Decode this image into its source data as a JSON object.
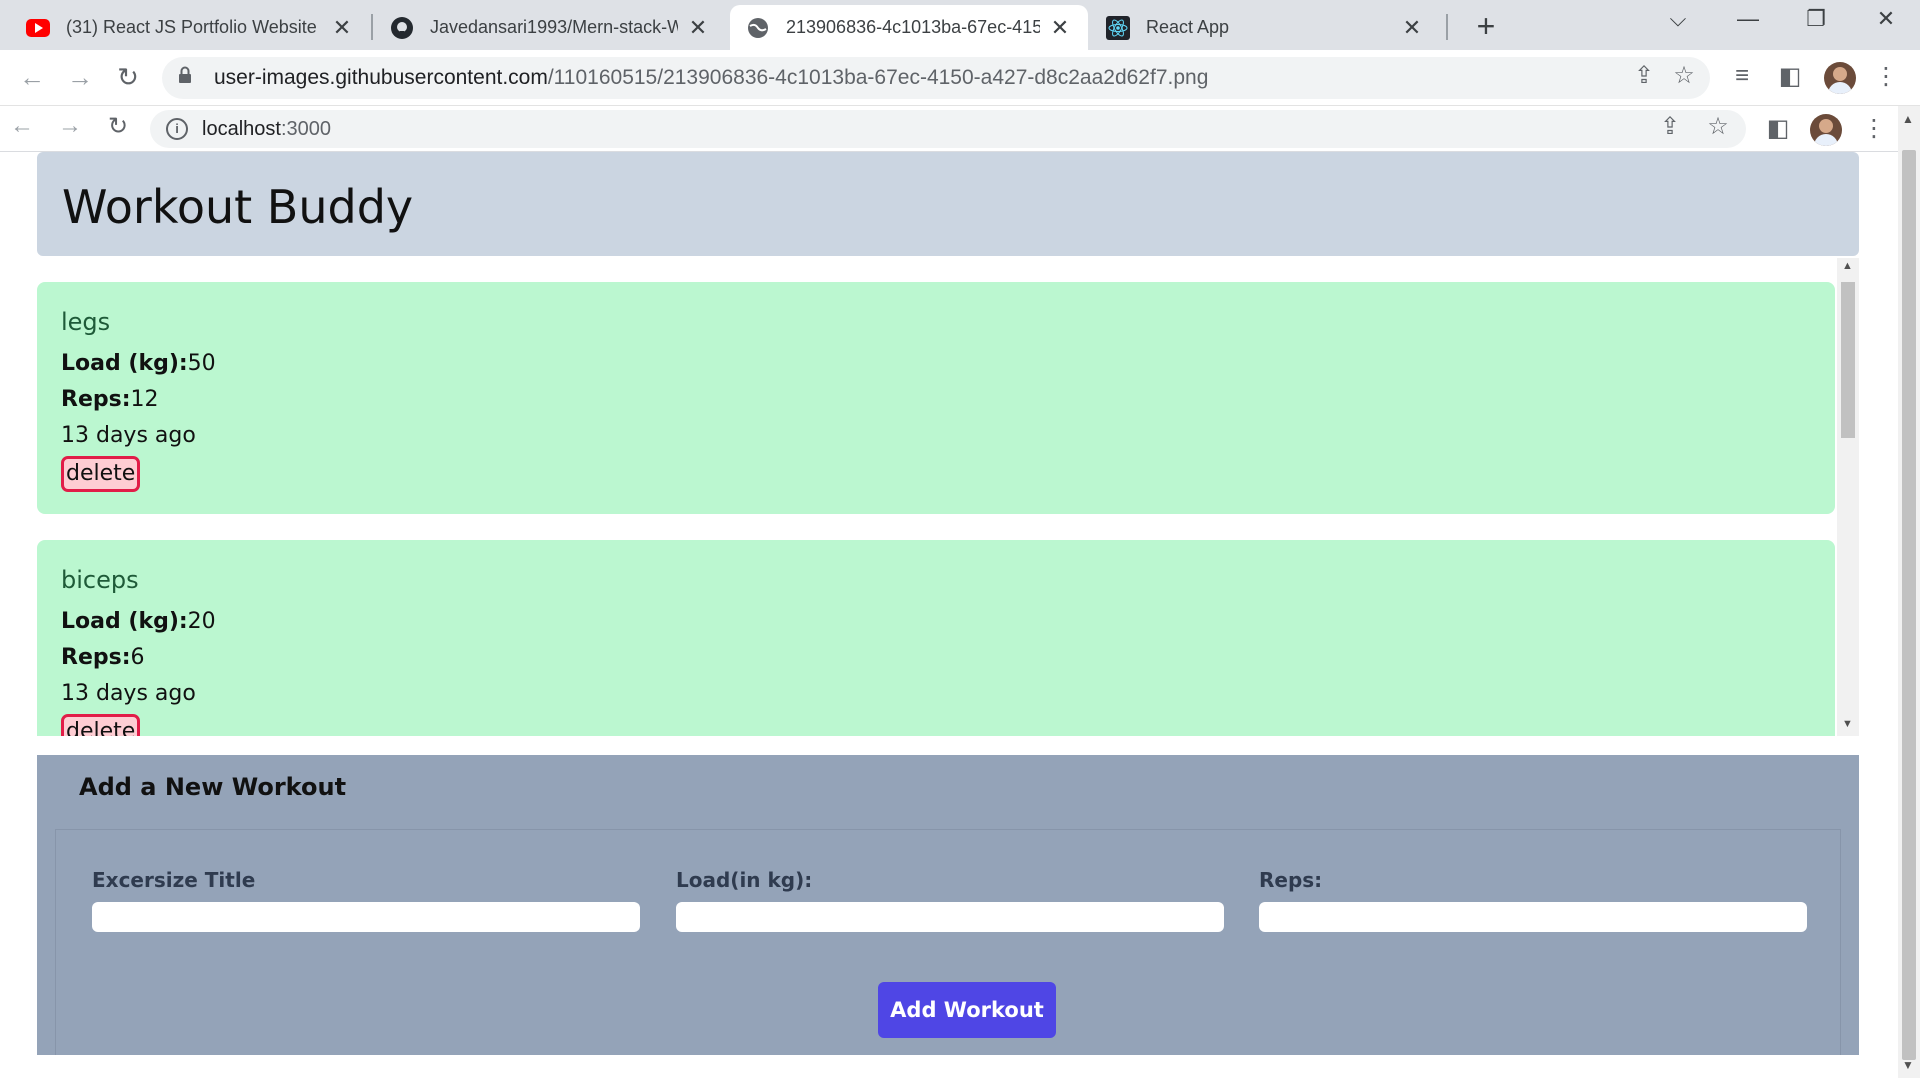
{
  "outer_browser": {
    "tabs": [
      {
        "title": "(31) React JS Portfolio Website Us",
        "icon": "youtube-icon"
      },
      {
        "title": "Javedansari1993/Mern-stack-Wo",
        "icon": "github-icon"
      },
      {
        "title": "213906836-4c1013ba-67ec-4150",
        "icon": "globe-icon"
      },
      {
        "title": "React App",
        "icon": "react-icon"
      }
    ],
    "new_tab": "+",
    "url_host": "user-images.githubusercontent.com",
    "url_path": "/110160515/213906836-4c1013ba-67ec-4150-a427-d8c2aa2d62f7.png"
  },
  "inner_browser": {
    "url_host": "localhost",
    "url_port": ":3000"
  },
  "app": {
    "title": "Workout Buddy",
    "workouts": [
      {
        "name": "legs",
        "load_label": "Load (kg):",
        "load": "50",
        "reps_label": "Reps:",
        "reps": "12",
        "time": "13 days ago",
        "delete": "delete"
      },
      {
        "name": "biceps",
        "load_label": "Load (kg):",
        "load": "20",
        "reps_label": "Reps:",
        "reps": "6",
        "time": "13 days ago",
        "delete": "delete"
      }
    ],
    "form": {
      "title": "Add a New Workout",
      "title_label": "Excersize Title",
      "load_label": "Load(in kg):",
      "reps_label": "Reps:",
      "submit": "Add Workout"
    }
  },
  "colors": {
    "header_bg": "#cbd5e1",
    "card_bg": "#bbf7d0",
    "delete_bg": "#fecdd3",
    "delete_border": "#e11d48",
    "form_bg": "#94a3b8",
    "button_bg": "#4f46e5"
  }
}
